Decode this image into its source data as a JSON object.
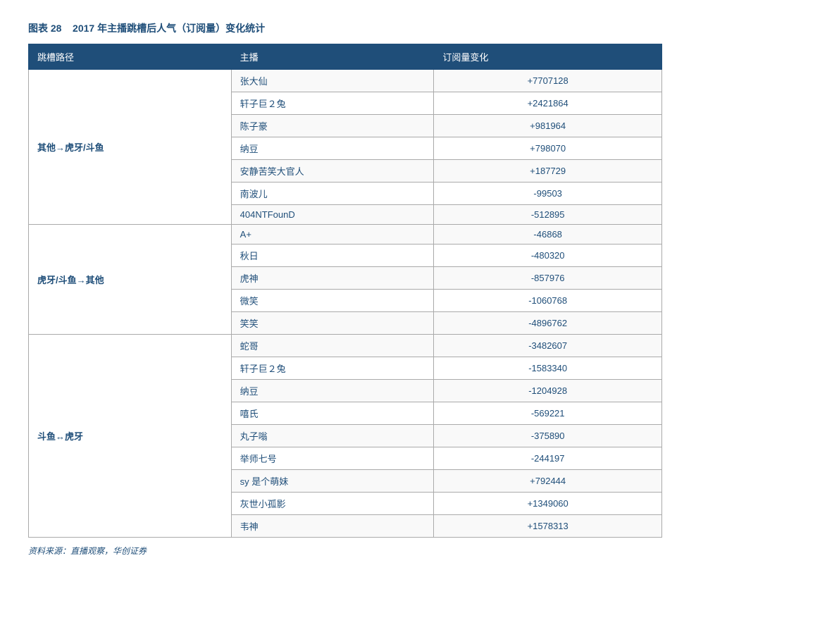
{
  "title": {
    "prefix": "图表 28",
    "text": "2017 年主播跳槽后人气（订阅量）变化统计"
  },
  "columns": [
    "跳槽路径",
    "主播",
    "订阅量变化"
  ],
  "groups": [
    {
      "path": "其他→虎牙/斗鱼",
      "rows": [
        {
          "host": "张大仙",
          "change": "+7707128"
        },
        {
          "host": "轩子巨２兔",
          "change": "+2421864"
        },
        {
          "host": "陈子豪",
          "change": "+981964"
        },
        {
          "host": "纳豆",
          "change": "+798070"
        },
        {
          "host": "安静苦笑大官人",
          "change": "+187729"
        },
        {
          "host": "南波儿",
          "change": "-99503"
        },
        {
          "host": "404NTFounD",
          "change": "-512895"
        }
      ]
    },
    {
      "path": "虎牙/斗鱼→其他",
      "rows": [
        {
          "host": "A+",
          "change": "-46868"
        },
        {
          "host": "秋日",
          "change": "-480320"
        },
        {
          "host": "虎神",
          "change": "-857976"
        },
        {
          "host": "微笑",
          "change": "-1060768"
        },
        {
          "host": "笑笑",
          "change": "-4896762"
        }
      ]
    },
    {
      "path": "斗鱼↔虎牙",
      "rows": [
        {
          "host": "蛇哥",
          "change": "-3482607"
        },
        {
          "host": "轩子巨２兔",
          "change": "-1583340"
        },
        {
          "host": "纳豆",
          "change": "-1204928"
        },
        {
          "host": "嘻氏",
          "change": "-569221"
        },
        {
          "host": "丸子嗡",
          "change": "-375890"
        },
        {
          "host": "举师七号",
          "change": "-244197"
        },
        {
          "host": "sy 是个萌妹",
          "change": "+792444"
        },
        {
          "host": "灰世小孤影",
          "change": "+1349060"
        },
        {
          "host": "韦神",
          "change": "+1578313"
        }
      ]
    }
  ],
  "source": "资料来源：直播观察，华创证券"
}
